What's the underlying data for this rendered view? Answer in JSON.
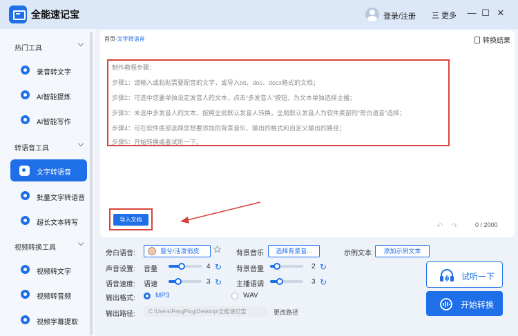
{
  "app": {
    "title": "全能速记宝",
    "login": "登录/注册",
    "more": "三 更多"
  },
  "window_controls": {
    "minimize": "—",
    "maximize": "☐",
    "close": "✕"
  },
  "sidebar": {
    "groups": [
      {
        "title": "热门工具",
        "items": [
          {
            "label": "录音转文字"
          },
          {
            "label": "AI智能提炼"
          },
          {
            "label": "AI智能写作"
          }
        ]
      },
      {
        "title": "转语音工具",
        "items": [
          {
            "label": "文字转语音",
            "active": true
          },
          {
            "label": "批量文字转语音"
          },
          {
            "label": "超长文本转写"
          }
        ]
      },
      {
        "title": "视频转换工具",
        "items": [
          {
            "label": "视频转文字"
          },
          {
            "label": "视频转音频"
          },
          {
            "label": "视频字幕提取"
          }
        ]
      }
    ]
  },
  "main": {
    "breadcrumb": {
      "home": "首页",
      "sep": "-",
      "current": "文字转语音"
    },
    "result_label": "转换结果",
    "tutorial": [
      "制作教程步骤：",
      "步骤1：请输入或粘贴需要配音的文字，或导入txt、doc、docx格式的文档；",
      "步骤2：可选中您要单独设定发音人的文本，点击“多发音人”按钮，为文本单独选择主播；",
      "步骤3：未选中多发音人的文本，按照全局默认发音人转换，全局默认发音人为软件底部的“旁白语音”选择；",
      "步骤4：可在软件底部选择您想要添加的背景音乐、输出的格式和自定义输出的路径；",
      "步骤5：开始转换或者试听一下。"
    ],
    "import_button": "导入文档",
    "undo": "↶",
    "redo": "↷",
    "char_count": "0 / 2000"
  },
  "settings": {
    "narration_label": "旁白语音:",
    "narration_voice": "晋兮/活泼俏皮",
    "favorite": "☆",
    "bgm_label": "背景音乐",
    "bgm_button": "选择背景音...",
    "sample_label": "示例文本",
    "sample_button": "添加示例文本",
    "voice_setting_label": "声音设置:",
    "volume_label": "音量",
    "volume_value": "4",
    "volume_level": 0.4,
    "bg_volume_label": "背景音量",
    "bg_volume_value": "2",
    "bg_volume_level": 0.2,
    "speed_setting_label": "语音速度:",
    "speed_label": "语速",
    "speed_value": "3",
    "speed_level": 0.3,
    "pitch_label": "主播语调",
    "pitch_value": "3",
    "pitch_level": 0.3,
    "reset_glyph": "↻",
    "format_label": "输出格式:",
    "format_mp3": "MP3",
    "format_wav": "WAV",
    "path_label": "输出路径:",
    "path_value": "C:\\Users\\FengPing\\Desktop\\全能速记宝",
    "change_path": "更改路径"
  },
  "actions": {
    "listen": "试听一下",
    "start": "开始转换"
  },
  "colors": {
    "accent": "#1e6fe8",
    "highlight": "#d9413a"
  }
}
